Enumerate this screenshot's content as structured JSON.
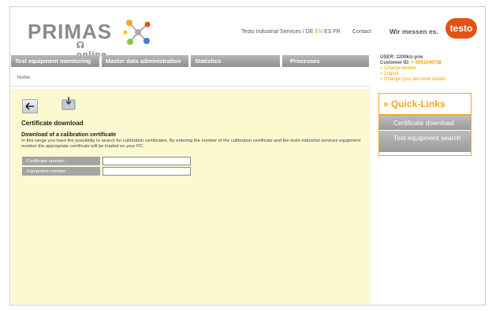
{
  "header": {
    "logo_main": "PRIMAS",
    "logo_sub": "online",
    "nav_prefix": "Testo Industrial Services /",
    "langs": [
      "DE",
      "EN",
      "ES",
      "FR"
    ],
    "active_lang": "EN",
    "contact": "Contact",
    "slogan": "Wir messen es.",
    "brand": "testo"
  },
  "menu": {
    "items": [
      "Test equipment monitoring",
      "Master data administration",
      "Statistics",
      "Processes"
    ]
  },
  "breadcrumb": "Home",
  "user": {
    "user_line": "USER: 1200kiz-prw",
    "customer_label": "Customer ID:",
    "customer_id": "> 0001040738",
    "links": [
      "> Change debitor",
      "> Logout",
      "> Change your personal details"
    ]
  },
  "page": {
    "title": "Certificate download",
    "section_title": "Download of a calibration certificate",
    "description": "In this range you have the possibility to search for calibration certificates. By entering the number of the calibration certificate and the testo industrial services equipment number the appropriate certificate will be loaded on your PC.",
    "fields": [
      {
        "label": "Certificate number:",
        "value": ""
      },
      {
        "label": "Equipment number:",
        "value": ""
      }
    ]
  },
  "quick_links": {
    "title": "» Quick-Links",
    "items": [
      "Certificate download",
      "Test equipment search"
    ]
  },
  "colors": {
    "accent": "#f5a623",
    "content_bg": "#fcf8cf",
    "menu_grey": "#a0a0a0",
    "brand": "#e25314"
  },
  "icons": [
    "back-arrow-icon",
    "save-download-icon",
    "molecule-logo-icon"
  ]
}
